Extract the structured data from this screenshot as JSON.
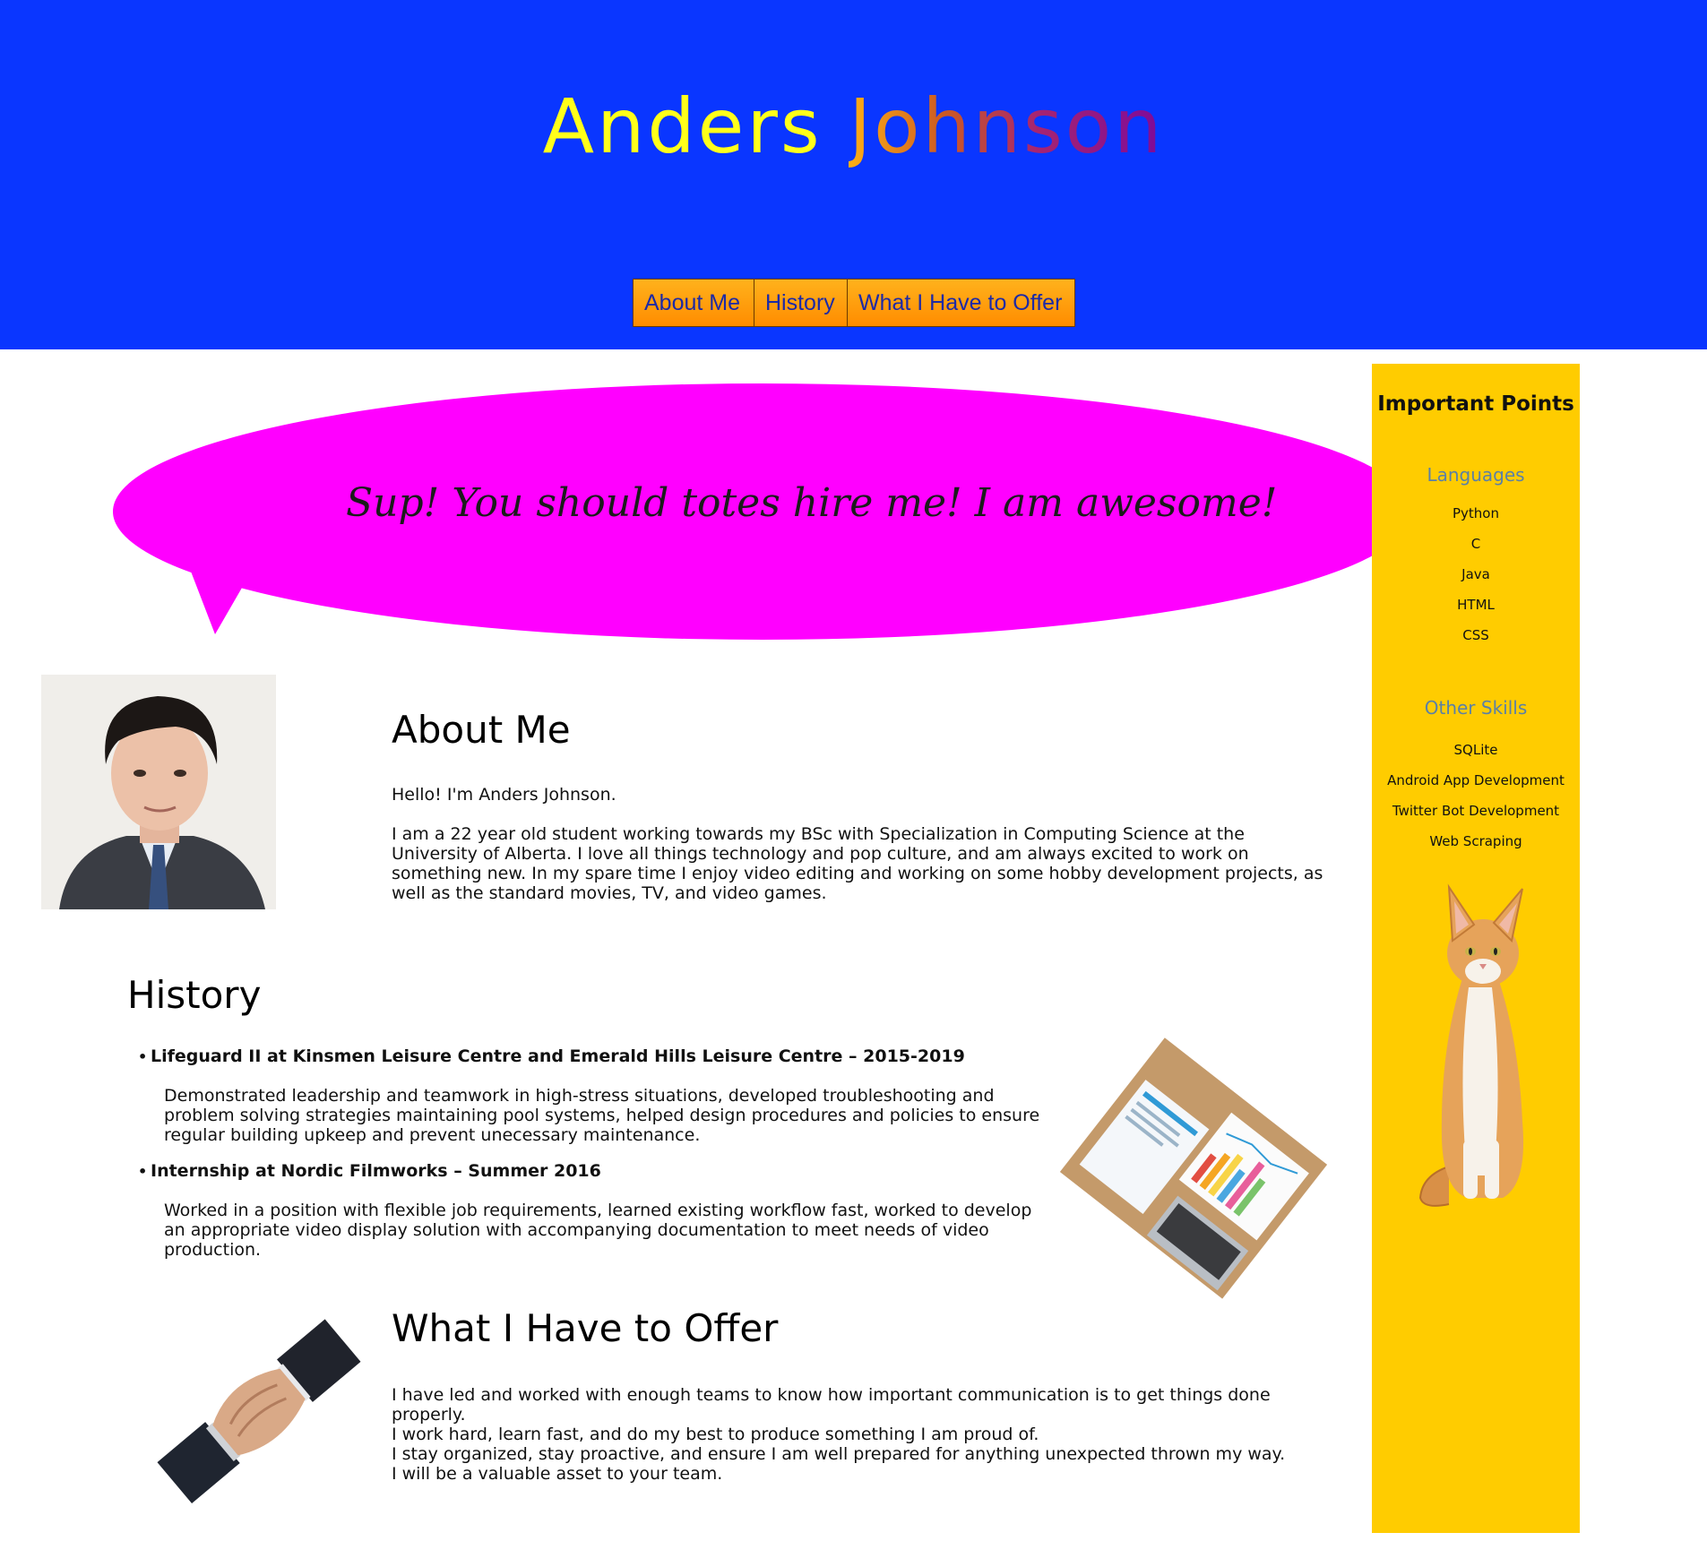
{
  "header": {
    "title_first": "Anders",
    "title_last": "Johnson",
    "background_color": "#0a36ff"
  },
  "nav": {
    "items": [
      {
        "label": "About Me"
      },
      {
        "label": "History"
      },
      {
        "label": "What I Have to Offer"
      }
    ]
  },
  "bubble": {
    "text": "Sup! You should totes hire me! I am awesome!",
    "color": "#ff00ff"
  },
  "sidebar": {
    "title": "Important Points",
    "languages_heading": "Languages",
    "languages": [
      "Python",
      "C",
      "Java",
      "HTML",
      "CSS"
    ],
    "skills_heading": "Other Skills",
    "skills": [
      "SQLite",
      "Android App Development",
      "Twitter Bot Development",
      "Web Scraping"
    ],
    "background_color": "#ffcc00"
  },
  "about": {
    "heading": "About Me",
    "greeting": "Hello! I'm Anders Johnson.",
    "body": "I am a 22 year old student working towards my BSc with Specialization in Computing Science at the University of Alberta. I love all things technology and pop culture, and am always excited to work on something new. In my spare time I enjoy video editing and working on some hobby development projects, as well as the standard movies, TV, and video games."
  },
  "history": {
    "heading": "History",
    "jobs": [
      {
        "title": "Lifeguard II at Kinsmen Leisure Centre and Emerald Hills Leisure Centre – 2015-2019",
        "description": "Demonstrated leadership and teamwork in high-stress situations, developed troubleshooting and problem solving strategies maintaining pool systems, helped design procedures and policies to ensure regular building upkeep and prevent unecessary maintenance."
      },
      {
        "title": "Internship at Nordic Filmworks – Summer 2016",
        "description": "Worked in a position with flexible job requirements, learned existing workflow fast, worked to develop an appropriate video display solution with accompanying documentation to meet needs of video production."
      }
    ]
  },
  "offer": {
    "heading": "What I Have to Offer",
    "lines": [
      "I have led and worked with enough teams to know how important communication is to get things done properly.",
      "I work hard, learn fast, and do my best to produce something I am proud of.",
      "I stay organized, stay proactive, and ensure I am well prepared for anything unexpected thrown my way."
    ],
    "closing": "I will be a valuable asset to your team."
  }
}
